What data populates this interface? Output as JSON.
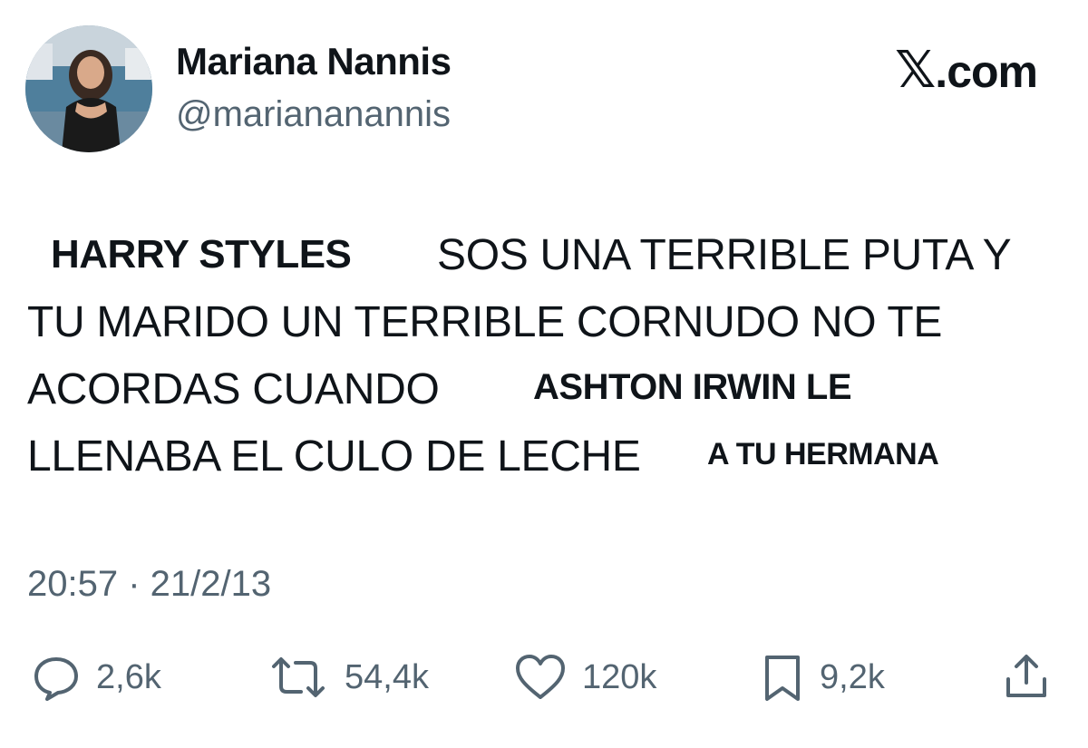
{
  "user": {
    "name": "Mariana Nannis",
    "handle": "@mariananannis",
    "avatar_icon": "profile-photo"
  },
  "brand": {
    "x_mark": "𝕏",
    "text": ".com"
  },
  "tweet": {
    "line1": {
      "overlay1": "HARRY STYLES",
      "text": "SOS UNA TERRIBLE PUTA Y"
    },
    "line2": {
      "text": "TU MARIDO UN TERRIBLE CORNUDO NO TE"
    },
    "line3": {
      "text": "ACORDAS CUANDO",
      "overlay": "ASHTON IRWIN LE"
    },
    "line4": {
      "text": "LLENABA EL CULO DE LECHE",
      "overlay": "A TU HERMANA"
    },
    "timestamp": "20:57 · 21/2/13"
  },
  "actions": [
    {
      "icon": "reply-icon",
      "count": "2,6k"
    },
    {
      "icon": "retweet-icon",
      "count": "54,4k"
    },
    {
      "icon": "like-icon",
      "count": "120k"
    },
    {
      "icon": "bookmark-icon",
      "count": "9,2k"
    },
    {
      "icon": "share-icon",
      "count": ""
    }
  ]
}
